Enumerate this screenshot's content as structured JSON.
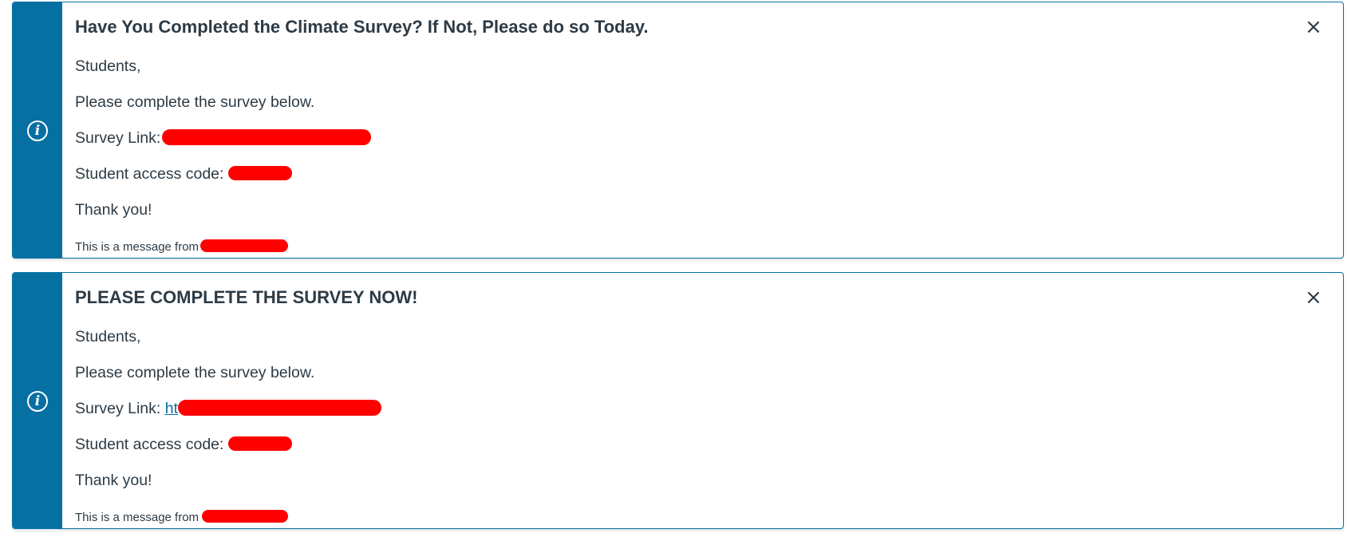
{
  "alerts": [
    {
      "title": "Have You Completed the Climate Survey? If Not, Please do so Today.",
      "greeting": "Students,",
      "instruction": "Please complete the survey below.",
      "survey_link_label": "Survey Link:",
      "survey_link_visible": "",
      "access_code_label": "Student access code:",
      "thanks": "Thank you!",
      "footer_label": "This is a message from",
      "close_glyph": "×"
    },
    {
      "title": "PLEASE COMPLETE THE SURVEY NOW!",
      "greeting": "Students,",
      "instruction": "Please complete the survey below.",
      "survey_link_label": "Survey Link:",
      "survey_link_visible": "ht",
      "access_code_label": "Student access code:",
      "thanks": "Thank you!",
      "footer_label": "This is a message from",
      "close_glyph": "×"
    }
  ],
  "colors": {
    "accent": "#0770a3",
    "text": "#2d3b45",
    "redaction": "#ff0000"
  },
  "icons": [
    "info-icon",
    "close-icon"
  ]
}
